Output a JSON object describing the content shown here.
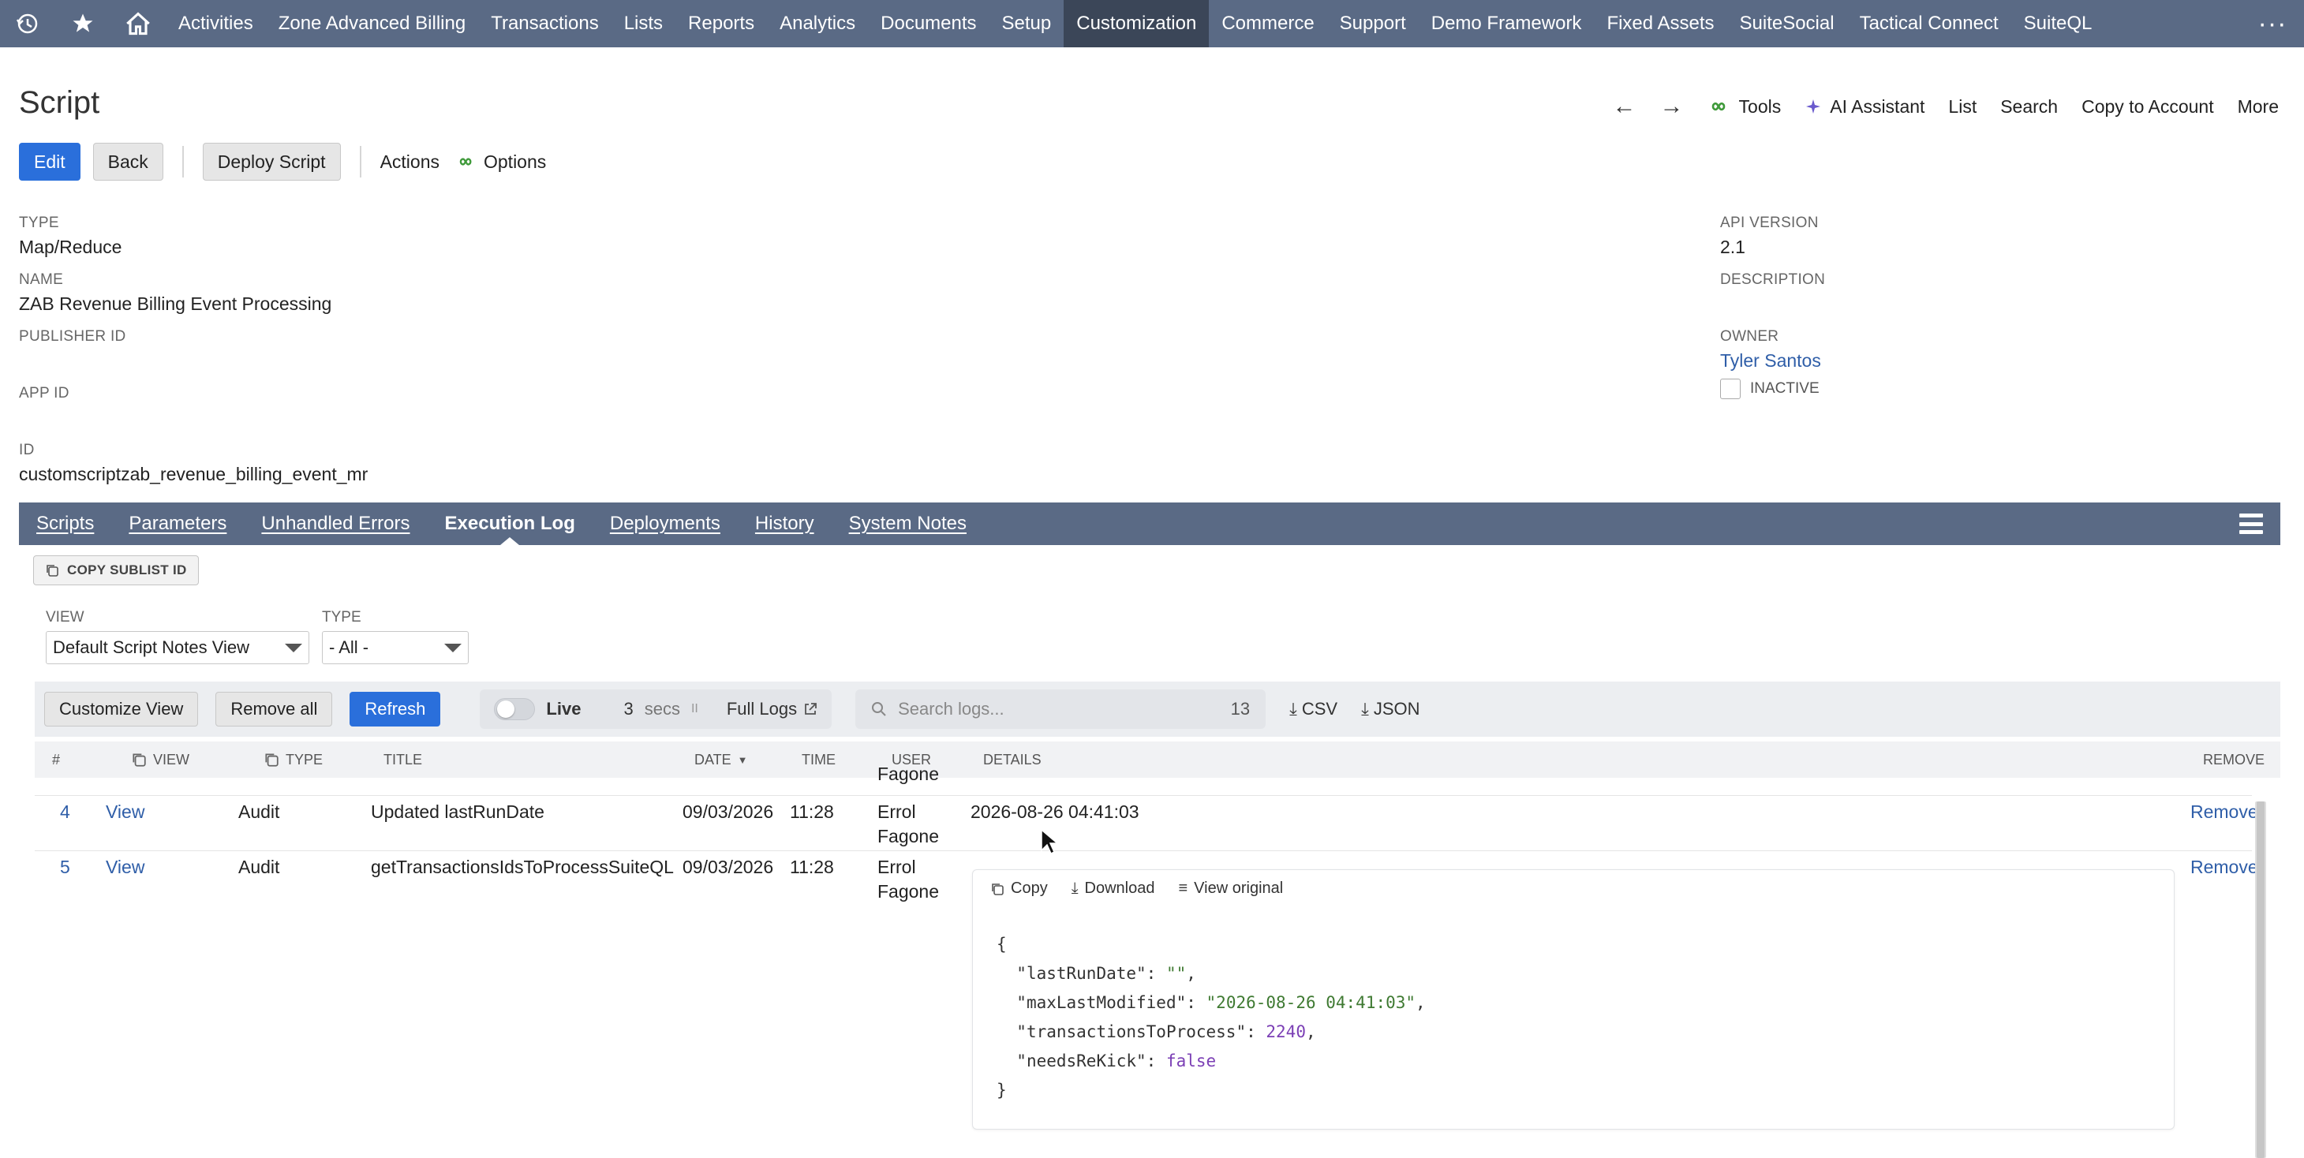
{
  "nav": {
    "items": [
      "Activities",
      "Zone Advanced Billing",
      "Transactions",
      "Lists",
      "Reports",
      "Analytics",
      "Documents",
      "Setup",
      "Customization",
      "Commerce",
      "Support",
      "Demo Framework",
      "Fixed Assets",
      "SuiteSocial",
      "Tactical Connect",
      "SuiteQL"
    ],
    "active": "Customization",
    "more": "···"
  },
  "page": {
    "title": "Script",
    "tools": {
      "tools": "Tools",
      "ai": "AI Assistant",
      "list": "List",
      "search": "Search",
      "copy": "Copy to Account",
      "more": "More"
    },
    "buttons": {
      "edit": "Edit",
      "back": "Back",
      "deploy": "Deploy Script",
      "actions": "Actions",
      "options": "Options"
    }
  },
  "fields": {
    "type_label": "TYPE",
    "type_value": "Map/Reduce",
    "name_label": "NAME",
    "name_value": "ZAB Revenue Billing Event Processing",
    "publisher_label": "PUBLISHER ID",
    "appid_label": "APP ID",
    "id_label": "ID",
    "id_value": "customscriptzab_revenue_billing_event_mr",
    "api_label": "API VERSION",
    "api_value": "2.1",
    "desc_label": "DESCRIPTION",
    "owner_label": "OWNER",
    "owner_value": "Tyler Santos",
    "inactive_label": "INACTIVE"
  },
  "tabs": [
    "Scripts",
    "Parameters",
    "Unhandled Errors",
    "Execution Log",
    "Deployments",
    "History",
    "System Notes"
  ],
  "active_tab": "Execution Log",
  "sublist": {
    "copy_id": "COPY SUBLIST ID",
    "view_label": "VIEW",
    "view_value": "Default Script Notes View",
    "type_label": "TYPE",
    "type_value": "- All -"
  },
  "logbar": {
    "customize": "Customize View",
    "remove_all": "Remove all",
    "refresh": "Refresh",
    "live": "Live",
    "secs_value": "3",
    "secs": "secs",
    "pause": "II",
    "full_logs": "Full Logs",
    "search_placeholder": "Search logs...",
    "count": "13",
    "csv": "CSV",
    "json": "JSON"
  },
  "table": {
    "headers": {
      "num": "#",
      "view": "VIEW",
      "type": "TYPE",
      "title": "TITLE",
      "date": "DATE",
      "time": "TIME",
      "user": "USER",
      "details": "DETAILS",
      "remove": "REMOVE"
    },
    "partial_user": "Fagone",
    "rows": [
      {
        "num": "4",
        "view": "View",
        "type": "Audit",
        "title": "Updated lastRunDate",
        "date": "09/03/2026",
        "time": "11:28",
        "user1": "Errol",
        "user2": "Fagone",
        "details": "2026-08-26 04:41:03",
        "remove": "Remove"
      },
      {
        "num": "5",
        "view": "View",
        "type": "Audit",
        "title": "getTransactionsIdsToProcessSuiteQL",
        "date": "09/03/2026",
        "time": "11:28",
        "user1": "Errol",
        "user2": "Fagone",
        "details": "",
        "remove": "Remove"
      }
    ]
  },
  "details_box": {
    "copy": "Copy",
    "download": "Download",
    "view_original": "View original",
    "json_open": "{",
    "lines": [
      {
        "key": "\"lastRunDate\"",
        "value": "\"\"",
        "kind": "s",
        "comma": ","
      },
      {
        "key": "\"maxLastModified\"",
        "value": "\"2026-08-26 04:41:03\"",
        "kind": "s",
        "comma": ","
      },
      {
        "key": "\"transactionsToProcess\"",
        "value": "2240",
        "kind": "n",
        "comma": ","
      },
      {
        "key": "\"needsReKick\"",
        "value": "false",
        "kind": "n",
        "comma": ""
      }
    ],
    "json_close": "}"
  },
  "colors": {
    "nav_bg": "#5a6a85",
    "nav_active": "#3b4658",
    "primary": "#2a6fdb",
    "link": "#2f5ea8"
  }
}
